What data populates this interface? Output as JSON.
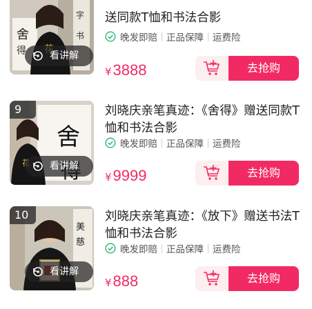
{
  "colors": {
    "accent": "#f22a63",
    "check": "#2bb673",
    "cart_bg": "#fdeef0"
  },
  "items": [
    {
      "rank": "",
      "title": "送同款T恤和书法合影",
      "tags": [
        "晚发即赔",
        "正品保障",
        "运费险"
      ],
      "price_symbol": "¥",
      "price": "3888",
      "explain_label": "看讲解",
      "buy_label": "去抢购"
    },
    {
      "rank": "9",
      "title": "刘晓庆亲笔真迹：《舍得》赠送同款T恤和书法合影",
      "tags": [
        "晚发即赔",
        "正品保障",
        "运费险"
      ],
      "price_symbol": "¥",
      "price": "9999",
      "explain_label": "看讲解",
      "buy_label": "去抢购"
    },
    {
      "rank": "10",
      "title": "刘晓庆亲笔真迹：《放下》赠送书法T恤和书法合影",
      "tags": [
        "晚发即赔",
        "正品保障",
        "运费险"
      ],
      "price_symbol": "¥",
      "price": "888",
      "explain_label": "看讲解",
      "buy_label": "去抢购"
    }
  ]
}
